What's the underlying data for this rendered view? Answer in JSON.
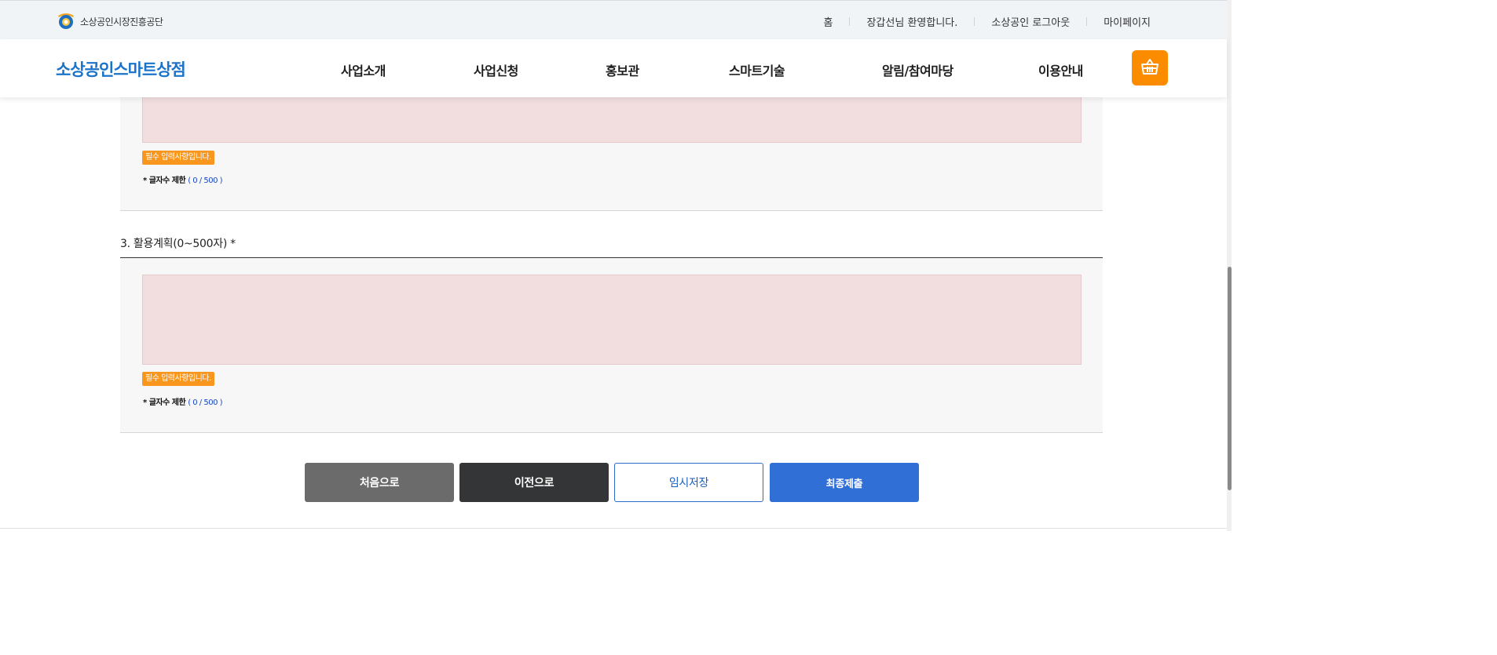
{
  "util_bar": {
    "org_name": "소상공인시장진흥공단",
    "links": [
      "홈",
      "장갑선님 환영합니다.",
      "소상공인 로그아웃",
      "마이페이지"
    ]
  },
  "header": {
    "site_name": "소상공인스마트상점",
    "nav": [
      "사업소개",
      "사업신청",
      "홍보관",
      "스마트기술",
      "알림/참여마당",
      "이용안내"
    ],
    "cart_icon": "basket-icon",
    "accent_color": "#fb8c00"
  },
  "section_prev": {
    "required_badge": "필수 입력사항입니다.",
    "char_limit_label": "* 글자수 제한",
    "char_limit_count": "( 0 / 500 )"
  },
  "section3": {
    "title": "3. 활용계획(0~500자)  *",
    "textarea_value": "",
    "required_badge": "필수 입력사항입니다.",
    "char_limit_label": "* 글자수 제한",
    "char_limit_count": "( 0 / 500 )"
  },
  "buttons": {
    "first": "처음으로",
    "prev": "이전으로",
    "temp_save": "임시저장",
    "final_submit": "최종제출"
  },
  "colors": {
    "brand_blue": "#1a73c9",
    "submit_blue": "#2f6fd6",
    "badge_orange": "#f8961d",
    "error_fill": "#f2dedf"
  }
}
